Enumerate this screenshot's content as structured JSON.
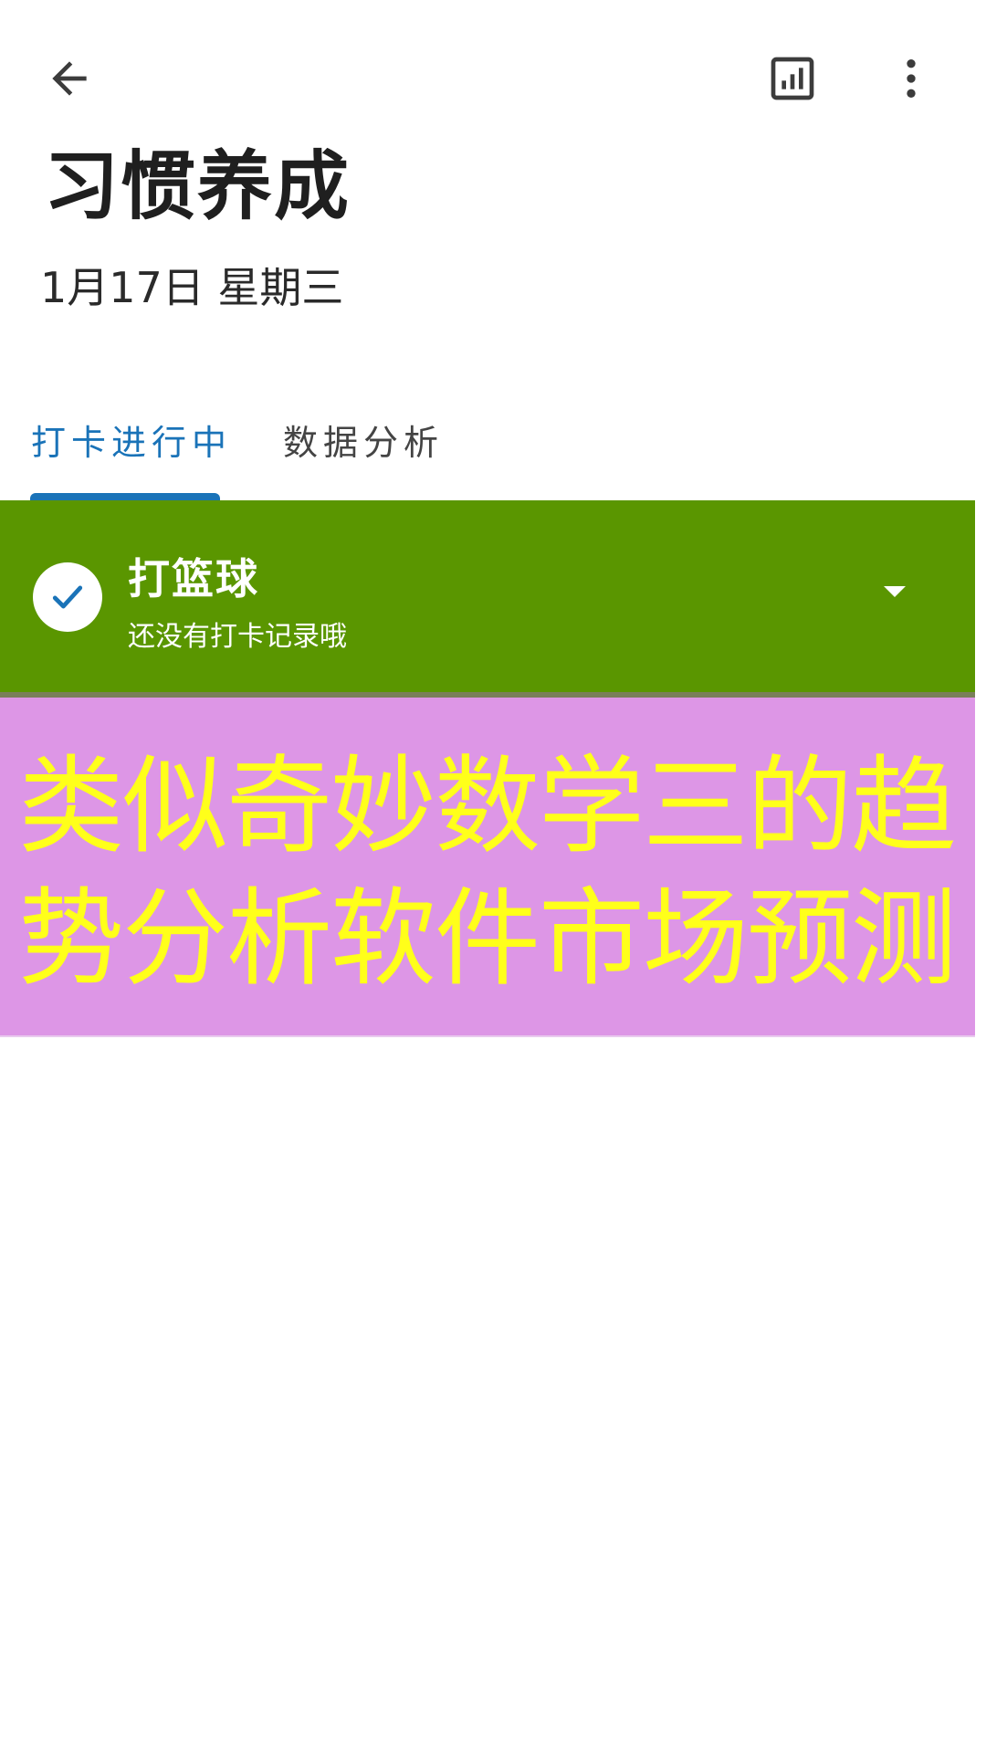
{
  "header": {
    "back_icon": "arrow-left-icon",
    "stats_icon": "bar-chart-icon",
    "more_icon": "more-vertical-icon",
    "title": "习惯养成",
    "date": "1月17日 星期三"
  },
  "tabs": [
    {
      "label": "打卡进行中",
      "active": true
    },
    {
      "label": "数据分析",
      "active": false
    }
  ],
  "habit": {
    "name": "打篮球",
    "subtitle": "还没有打卡记录哦",
    "check_icon": "check-icon",
    "expand_icon": "caret-down-icon",
    "card_color": "#5a9600"
  },
  "overlay": {
    "line1": "类似奇妙数学三的趋",
    "line2": "势分析软件市场预测",
    "background": "#dd96e6",
    "text_color": "#ffff1a"
  },
  "colors": {
    "accent": "#1a73b8"
  }
}
